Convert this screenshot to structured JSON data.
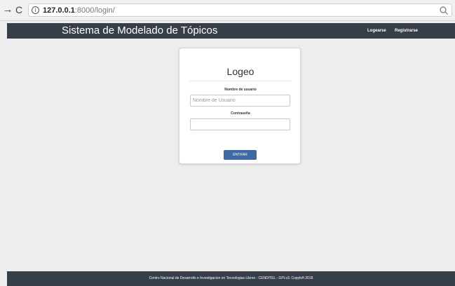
{
  "browser": {
    "forward_icon": "→",
    "reload_icon": "C",
    "info_icon": "i",
    "url_host": "127.0.0.1",
    "url_rest": ":8000/login/"
  },
  "navbar": {
    "brand": "Sistema de Modelado de Tópicos",
    "login_link": "Logearse",
    "register_link": "Registrarse",
    "background_color": "#353e49"
  },
  "login_card": {
    "title": "Logeo",
    "username_label": "Nombre de usuario",
    "username_placeholder": "Nombre de Usuario",
    "username_value": "",
    "password_label": "Contraseña",
    "password_value": "",
    "submit_label": "ENTRAR",
    "submit_color": "#3d6aa3"
  },
  "footer": {
    "text": "Centro Nacional de Desarrollo e Investigacion en Tecnologias Libres - CENDITEL - GPLv3.  Copyleft 2018"
  }
}
